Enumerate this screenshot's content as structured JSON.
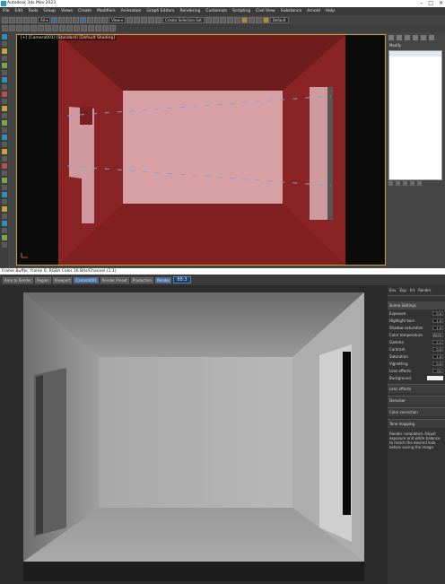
{
  "max_app": {
    "title": "Autodesk 3ds Max 2023",
    "menu": [
      "File",
      "Edit",
      "Tools",
      "Group",
      "Views",
      "Create",
      "Modifiers",
      "Animation",
      "Graph Editors",
      "Rendering",
      "Customize",
      "Scripting",
      "Civil View",
      "Substance",
      "Arnold",
      "Help"
    ],
    "workspace": "Default",
    "selection_set": "Create Selection Set",
    "viewport_label": "[+] [Camera001] [Standard] [Default Shading]",
    "command_panel_tab": "Modify"
  },
  "render_window": {
    "title": "Frame Buffer, frame 0, RGBA Color 16 Bits/Channel (1:1)",
    "toolbar": [
      "Area to Render",
      "Region",
      "Viewport",
      "Camera001",
      "Render Preset",
      "Production",
      "Render"
    ],
    "readout": "88:3",
    "settings_tabs": [
      "Env",
      "Exp",
      "Int",
      "Render"
    ],
    "settings_header": "Scene Settings",
    "settings_rows": [
      {
        "label": "Exposure",
        "value": "0.0"
      },
      {
        "label": "Highlight burn",
        "value": "1.0"
      },
      {
        "label": "Shadow saturation",
        "value": "1.0"
      },
      {
        "label": "Color temperature",
        "value": "6500"
      },
      {
        "label": "Gamma",
        "value": "2.2"
      },
      {
        "label": "Contrast",
        "value": "0.0"
      },
      {
        "label": "Saturation",
        "value": "1.0"
      },
      {
        "label": "Vignetting",
        "value": "0.0"
      },
      {
        "label": "Lens effects",
        "value": "On"
      },
      {
        "label": "Background",
        "value": ""
      }
    ],
    "sections": [
      "Lens effects",
      "Denoiser",
      "Color correction",
      "Tone mapping"
    ],
    "note": "Render completed. Adjust exposure and white balance to match the desired look before saving the image."
  },
  "colors": {
    "viewport_frame": "#c9a227",
    "room_wall": "#7a1f1f",
    "room_back": "#d6a0a5"
  }
}
